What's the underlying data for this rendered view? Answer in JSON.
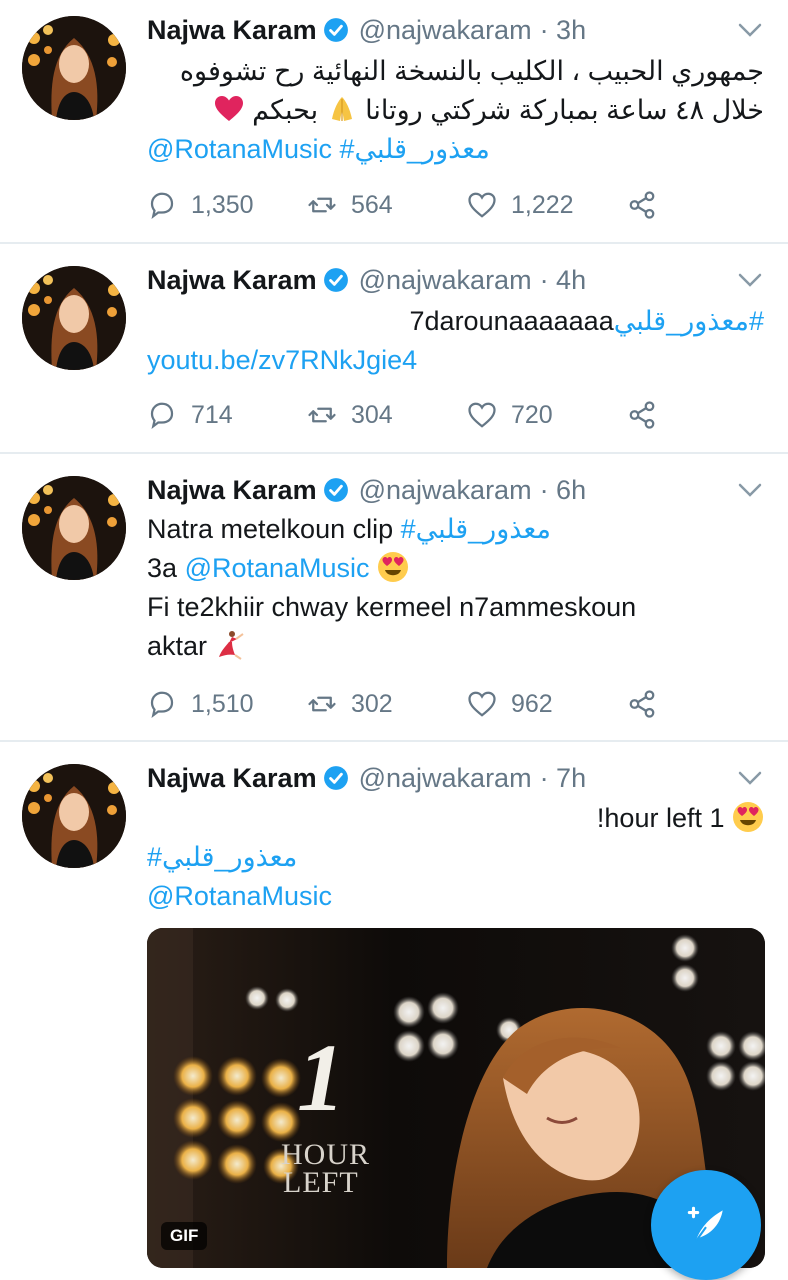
{
  "tweets": [
    {
      "author": "Najwa Karam",
      "handle": "@najwakaram",
      "time": "· 3h",
      "lines": [
        "جمهوري الحبيب ، الكليب بالنسخة النهائية رح تشوفوه",
        "خلال ٤٨ ساعة  بمباركة شركتي روتانا",
        "بحبكم"
      ],
      "link_line": {
        "mention": "@RotanaMusic",
        "hashtag": "#معذور_قلبي"
      },
      "replies": "1,350",
      "retweets": "564",
      "likes": "1,222"
    },
    {
      "author": "Najwa Karam",
      "handle": "@najwakaram",
      "time": "· 4h",
      "text_latin": "7darounaaaaaaa",
      "hashtag": "#معذور_قلبي",
      "url": "youtu.be/zv7RNkJgie4",
      "replies": "714",
      "retweets": "304",
      "likes": "720"
    },
    {
      "author": "Najwa Karam",
      "handle": "@najwakaram",
      "time": "· 6h",
      "line1_text": "Natra metelkoun clip",
      "line1_hashtag": "#معذور_قلبي",
      "line2_prefix": "3a",
      "line2_mention": "@RotanaMusic",
      "line3": "Fi te2khiir chway kermeel n7ammeskoun",
      "line4": "aktar",
      "replies": "1,510",
      "retweets": "302",
      "likes": "962"
    },
    {
      "author": "Najwa Karam",
      "handle": "@najwakaram",
      "time": "· 7h",
      "line1": "!hour left 1",
      "hashtag": "#معذور_قلبي",
      "mention": "@RotanaMusic",
      "media_big_number": "1",
      "media_text_1": "HOUR",
      "media_text_2": "LEFT",
      "media_badge": "GIF"
    }
  ],
  "icons": {
    "verified": "verified-badge-icon",
    "reply": "reply-icon",
    "retweet": "retweet-icon",
    "like": "heart-icon",
    "share": "share-icon",
    "menu": "chevron-down-icon",
    "compose": "compose-tweet-icon"
  },
  "colors": {
    "link": "#1da1f2",
    "muted": "#657786",
    "fab": "#1da1f2",
    "divider": "#e6ecf0"
  }
}
